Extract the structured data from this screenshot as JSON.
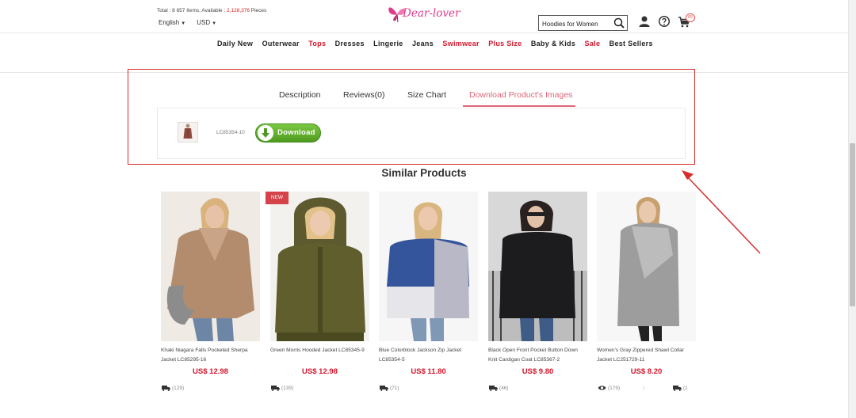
{
  "header": {
    "stock_prefix": "Total : 8 657 Items, Available : ",
    "stock_count": "2,128,376",
    "stock_suffix": " Pieces",
    "language": "English",
    "currency": "USD",
    "logo_text": "Dear-lover",
    "search_value": "Hoodies for Women",
    "cart_count": "65"
  },
  "nav": [
    {
      "label": "Daily New",
      "highlight": false
    },
    {
      "label": "Outerwear",
      "highlight": false
    },
    {
      "label": "Tops",
      "highlight": true
    },
    {
      "label": "Dresses",
      "highlight": false
    },
    {
      "label": "Lingerie",
      "highlight": false
    },
    {
      "label": "Jeans",
      "highlight": false
    },
    {
      "label": "Swimwear",
      "highlight": true
    },
    {
      "label": "Plus Size",
      "highlight": true
    },
    {
      "label": "Baby & Kids",
      "highlight": false
    },
    {
      "label": "Sale",
      "highlight": true
    },
    {
      "label": "Best Sellers",
      "highlight": false
    }
  ],
  "tabs": [
    {
      "label": "Description",
      "active": false
    },
    {
      "label": "Reviews(0)",
      "active": false
    },
    {
      "label": "Size Chart",
      "active": false
    },
    {
      "label": "Download Product's Images",
      "active": true
    }
  ],
  "download": {
    "sku": "LC85354-10",
    "button_label": "Download"
  },
  "similar": {
    "title": "Similar Products",
    "products": [
      {
        "name": "Khaki Niagara Falls Pocketed Sherpa Jacket LC85295-16",
        "price": "US$ 12.98",
        "count": "(129)",
        "is_new": false,
        "show_views": false
      },
      {
        "name": "Green Morris Hooded Jacket LC85345-9",
        "price": "US$ 12.98",
        "count": "(139)",
        "is_new": true,
        "new_label": "NEW",
        "show_views": false
      },
      {
        "name": "Blue Colorblock Jackson Zip Jacket LC85354-5",
        "price": "US$ 11.80",
        "count": "(71)",
        "is_new": false,
        "show_views": false
      },
      {
        "name": "Black Open Front Pocket Button Down Knit Cardigan Coat LC85367-2",
        "price": "US$ 9.80",
        "count": "(46)",
        "is_new": false,
        "show_views": false
      },
      {
        "name": "Women's Gray Zippered Shawl Collar Jacket LC251729-11",
        "price": "US$ 8.20",
        "count": "(179)",
        "truck_count": "(1",
        "is_new": false,
        "show_views": true
      }
    ]
  },
  "colors": {
    "accent_red": "#d5152a",
    "tab_active": "#e0667a",
    "highlight_box": "#d62c2c",
    "download_green": "#5aae26",
    "logo_pink": "#e03a8c"
  }
}
